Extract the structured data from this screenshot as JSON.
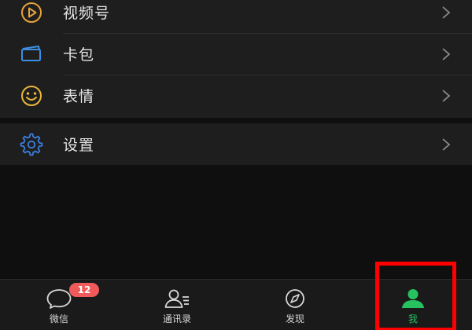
{
  "menu": {
    "items": [
      {
        "label": "视频号",
        "icon": "channels-play-icon",
        "icon_color": "#e8a33d"
      },
      {
        "label": "卡包",
        "icon": "card-wallet-icon",
        "icon_color": "#3b8fe0"
      },
      {
        "label": "表情",
        "icon": "smile-icon",
        "icon_color": "#e8b83a"
      }
    ],
    "settings": {
      "label": "设置",
      "icon": "gear-icon",
      "icon_color": "#3b7fe0"
    }
  },
  "tabbar": {
    "tabs": [
      {
        "label": "微信",
        "icon": "chat-bubble-icon",
        "badge": "12"
      },
      {
        "label": "通讯录",
        "icon": "contacts-icon"
      },
      {
        "label": "发现",
        "icon": "compass-icon"
      },
      {
        "label": "我",
        "icon": "person-icon",
        "active": true
      }
    ],
    "active_color": "#27c160",
    "badge_color": "#f05a5a"
  },
  "highlight": {
    "color": "#ff0000"
  }
}
